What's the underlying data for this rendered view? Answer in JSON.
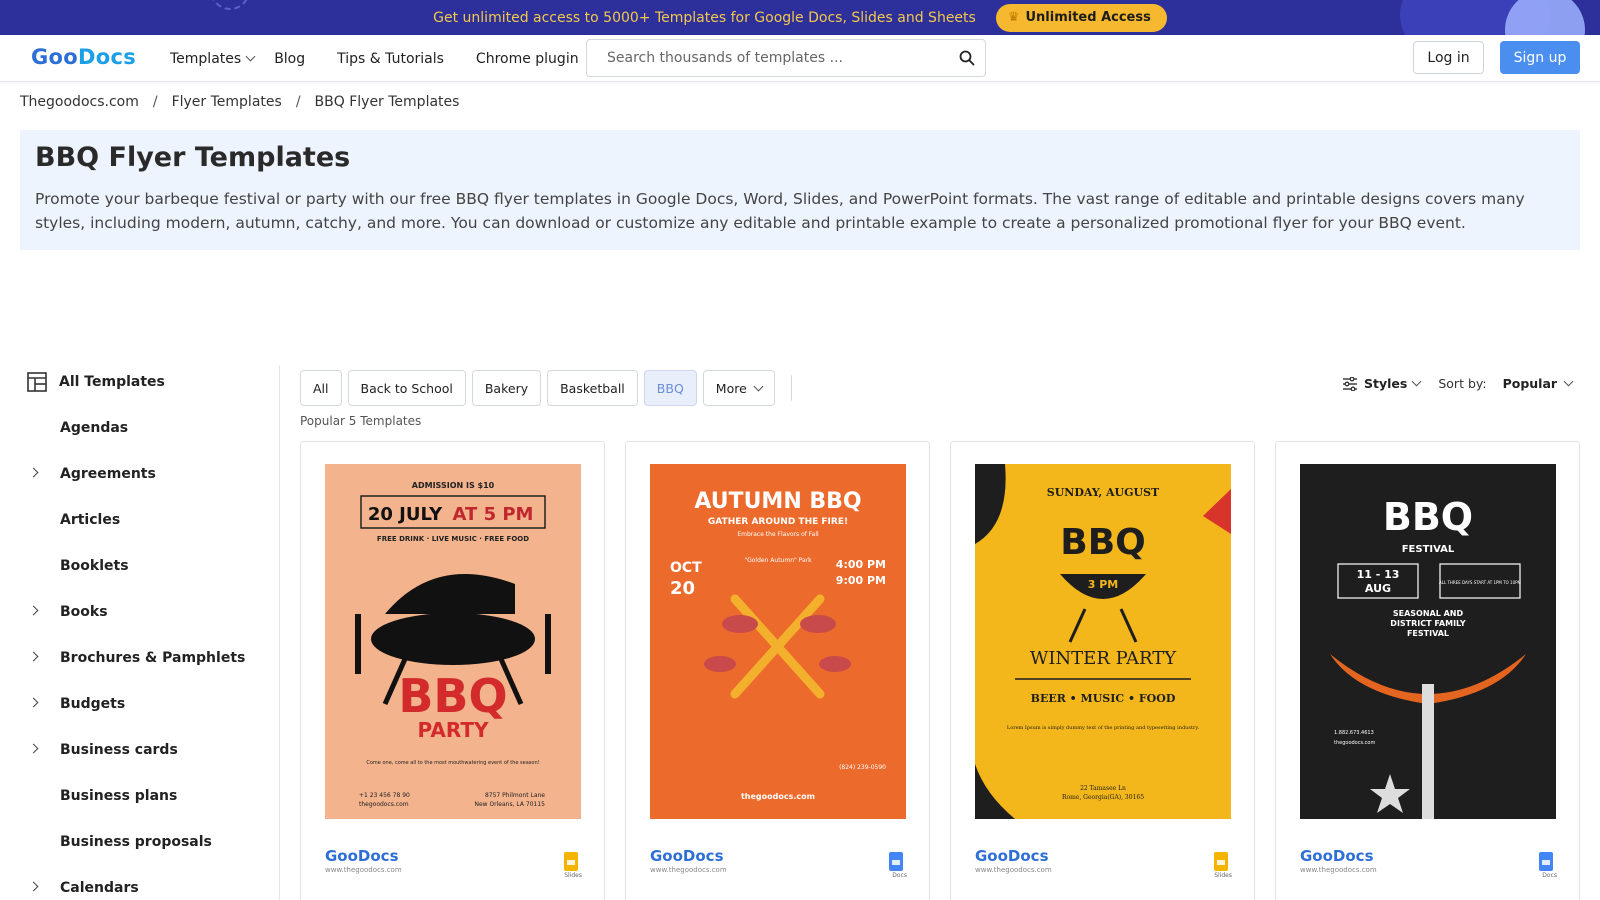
{
  "promo": {
    "text": "Get unlimited access to 5000+ Templates for Google Docs, Slides and Sheets",
    "button": "Unlimited Access",
    "colors": {
      "bg": "#2d2f9a",
      "text": "#f2c94c",
      "button": "#f5b82e"
    }
  },
  "header": {
    "logo_a": "Goo",
    "logo_b": "Docs",
    "nav": [
      "Templates",
      "Blog",
      "Tips & Tutorials",
      "Chrome plugin"
    ],
    "search_placeholder": "Search thousands of templates ...",
    "login": "Log in",
    "signup": "Sign up"
  },
  "breadcrumb": [
    "Thegoodocs.com",
    "Flyer Templates",
    "BBQ Flyer Templates"
  ],
  "hero": {
    "title": "BBQ Flyer Templates",
    "description": "Promote your barbeque festival or party with our free BBQ flyer templates in Google Docs, Word, Slides, and PowerPoint formats. The vast range of editable and printable designs covers many styles, including modern, autumn, catchy, and more. You can download or customize any editable and printable example to create a personalized promotional flyer for your BBQ event."
  },
  "sidebar": {
    "all": "All Templates",
    "items": [
      {
        "label": "Agendas",
        "expandable": false
      },
      {
        "label": "Agreements",
        "expandable": true
      },
      {
        "label": "Articles",
        "expandable": false
      },
      {
        "label": "Booklets",
        "expandable": false
      },
      {
        "label": "Books",
        "expandable": true
      },
      {
        "label": "Brochures & Pamphlets",
        "expandable": true
      },
      {
        "label": "Budgets",
        "expandable": true
      },
      {
        "label": "Business cards",
        "expandable": true
      },
      {
        "label": "Business plans",
        "expandable": false
      },
      {
        "label": "Business proposals",
        "expandable": false
      },
      {
        "label": "Calendars",
        "expandable": true
      }
    ]
  },
  "filters": {
    "chips": [
      "All",
      "Back to School",
      "Bakery",
      "Basketball",
      "BBQ"
    ],
    "active": "BBQ",
    "more": "More",
    "count": "Popular 5 Templates",
    "styles": "Styles",
    "sort_label": "Sort by:",
    "sort_value": "Popular"
  },
  "cards": [
    {
      "app": "slides",
      "app_label": "Slides",
      "poster": {
        "bg": "#f2b38d",
        "l1": "ADMISSION IS $10",
        "l2a": "20 JULY",
        "l2b": "AT 5 PM",
        "l3": "FREE DRINK · LIVE MUSIC · FREE FOOD",
        "l4": "BBQ",
        "l5": "PARTY",
        "l6": "Come one, come all to the most mouthwatering event of the season!",
        "l7": "+1 23 456 78 90",
        "l8": "thegoodocs.com",
        "l9": "8757 Philmont Lane",
        "l10": "New Orleans, LA 70115"
      }
    },
    {
      "app": "docs",
      "app_label": "Docs",
      "poster": {
        "bg": "#ec6a2b",
        "l1": "AUTUMN BBQ",
        "l2": "GATHER AROUND THE FIRE!",
        "l3": "Embrace the Flavors of Fall",
        "l4": "OCT",
        "l5": "20",
        "l6": "4:00 PM",
        "l7": "9:00 PM",
        "l8": "\"Golden Autumn\" Park",
        "l9": "thegoodocs.com",
        "l10": "(824) 239-0590"
      }
    },
    {
      "app": "slides",
      "app_label": "Slides",
      "poster": {
        "bg": "#f3b71b",
        "l1": "SUNDAY, AUGUST",
        "l2": "BBQ",
        "l3": "3 PM",
        "l4": "WINTER PARTY",
        "l5": "BEER • MUSIC • FOOD",
        "l6": "Lorem Ipsum is simply dummy text of the printing and typesetting industry.",
        "l7": "22 Tamasee Ln",
        "l8": "Rome, Georgia(GA), 30165"
      }
    },
    {
      "app": "docs",
      "app_label": "Docs",
      "poster": {
        "bg": "#1e1e1e",
        "l1": "BBQ",
        "l2": "FESTIVAL",
        "l3": "11 - 13",
        "l4": "AUG",
        "l5": "ALL THREE DAYS START AT 1PM TO 10PM",
        "l6": "SEASONAL AND",
        "l7": "DISTRICT FAMILY",
        "l8": "FESTIVAL",
        "l9": "1.882.673.4613",
        "l10": "thegoodocs.com"
      }
    }
  ],
  "card_logo": "GooDocs",
  "card_logo_sub": "www.thegoodocs.com"
}
